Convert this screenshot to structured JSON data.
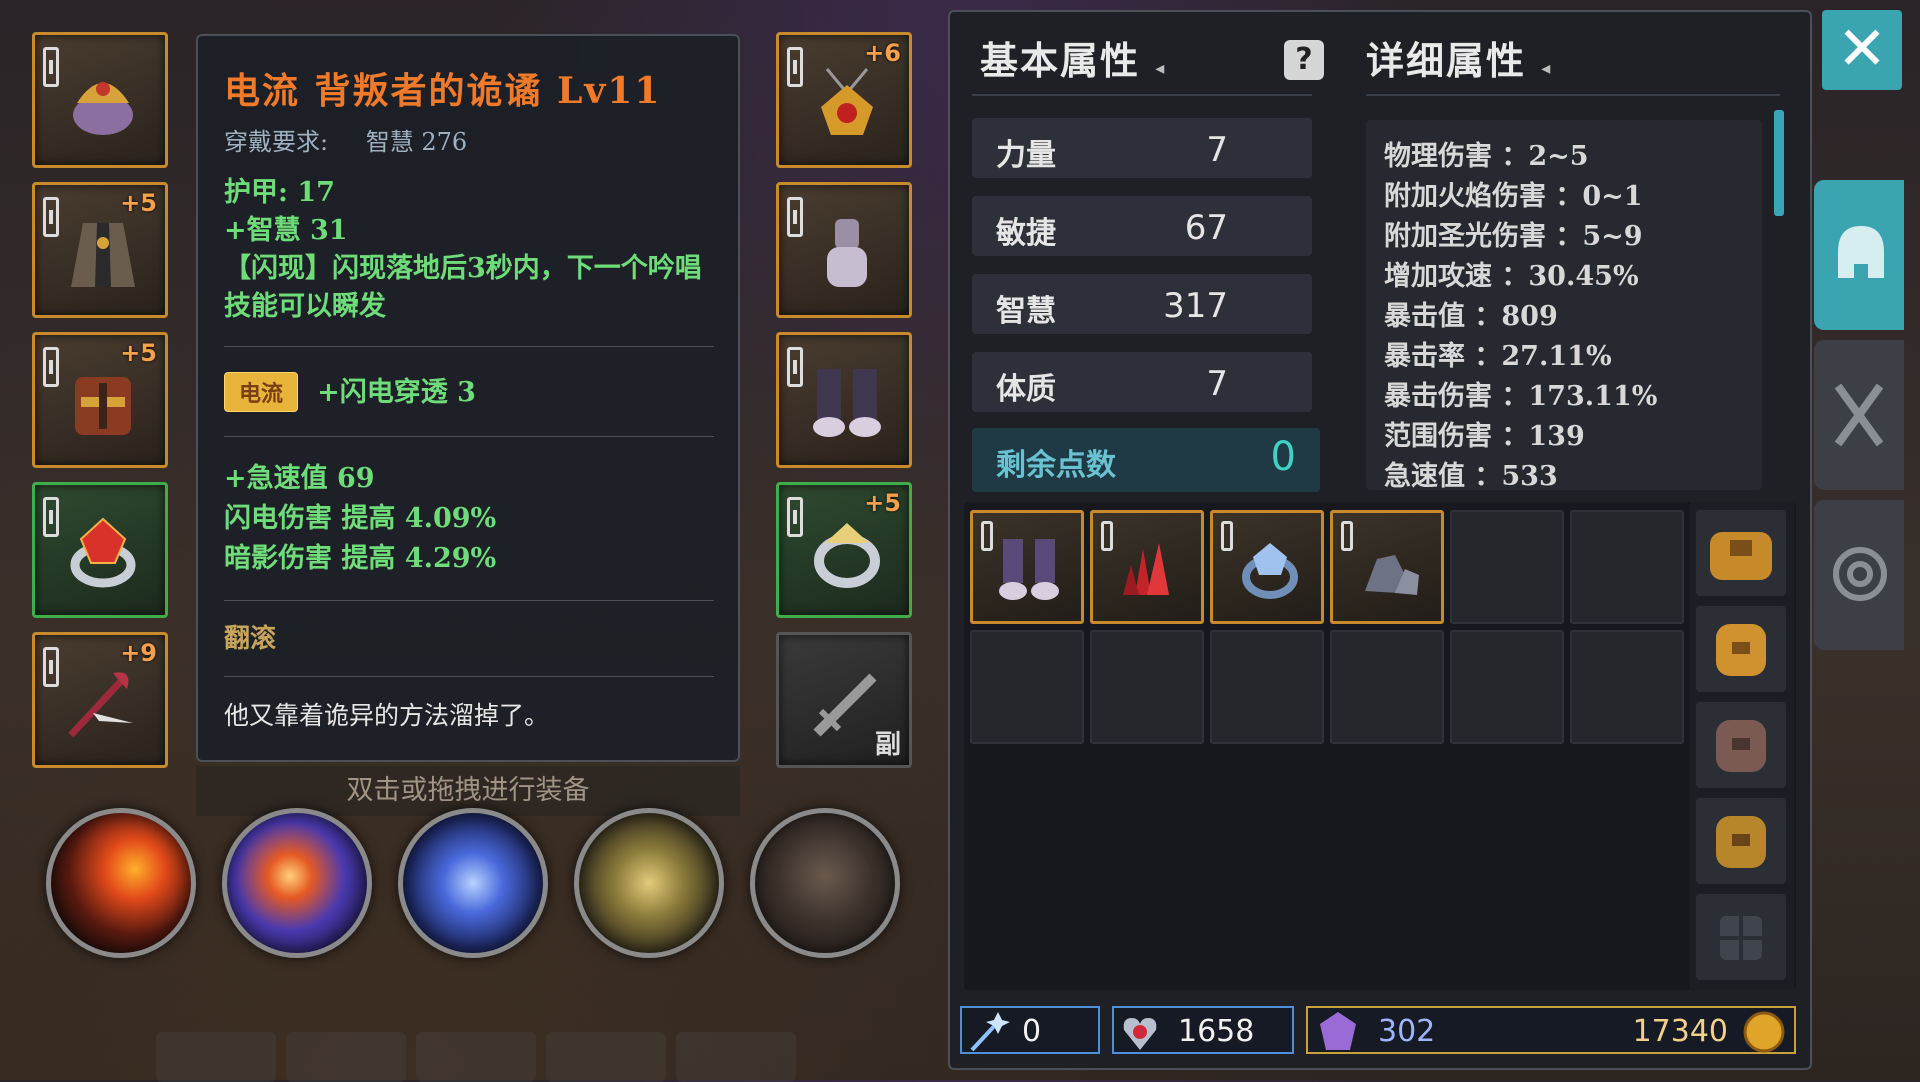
{
  "tooltip": {
    "title": "电流 背叛者的诡谲 Lv11",
    "req_label": "穿戴要求:",
    "req_value": "智慧 276",
    "armor": "护甲:  17",
    "int_bonus": "+智慧 31",
    "effect_line1": "【闪现】闪现落地后3秒内，下一个吟唱",
    "effect_line2": "技能可以瞬发",
    "element_tag": "电流",
    "element_bonus": "+闪电穿透 3",
    "haste": "+急速值 69",
    "lightning": "闪电伤害  提高  4.09%",
    "shadow": "暗影伤害  提高  4.29%",
    "skill_name": "翻滚",
    "flavor": "他又靠着诡异的方法溜掉了。"
  },
  "hint": "双击或拖拽进行装备",
  "equip_left": [
    {
      "name": "helmet-slot",
      "plus": "",
      "icon": "wizard-hat-icon"
    },
    {
      "name": "chest-slot",
      "plus": "+5",
      "icon": "robe-icon"
    },
    {
      "name": "waist-slot",
      "plus": "+5",
      "icon": "belt-armor-icon"
    },
    {
      "name": "ring-slot",
      "plus": "",
      "icon": "ruby-ring-icon"
    },
    {
      "name": "weapon-slot",
      "plus": "+9",
      "icon": "staff-icon"
    }
  ],
  "equip_right": [
    {
      "name": "amulet-slot",
      "plus": "+6",
      "icon": "amulet-icon"
    },
    {
      "name": "gloves-slot",
      "plus": "",
      "icon": "gauntlet-icon"
    },
    {
      "name": "boots-slot",
      "plus": "",
      "icon": "boots-icon"
    },
    {
      "name": "ring2-slot",
      "plus": "+5",
      "icon": "silver-ring-icon"
    },
    {
      "name": "offhand-slot",
      "plus": "",
      "icon": "sword-icon",
      "label": "副"
    }
  ],
  "basic": {
    "header": "基本属性",
    "stats": [
      {
        "label": "力量",
        "value": "7"
      },
      {
        "label": "敏捷",
        "value": "67"
      },
      {
        "label": "智慧",
        "value": "317"
      },
      {
        "label": "体质",
        "value": "7"
      }
    ],
    "remain_label": "剩余点数",
    "remain_value": "0"
  },
  "detail": {
    "header": "详细属性",
    "rows": [
      "物理伤害 ：2~5",
      "附加火焰伤害 ：0~1",
      "附加圣光伤害 ：5~9",
      "增加攻速 ：30.45%",
      "暴击值 ：809",
      "暴击率 ：27.11%",
      "暴击伤害 ：173.11%",
      "范围伤害 ：139",
      "急速值 ：533"
    ]
  },
  "inventory": [
    {
      "icon": "boots-icon",
      "filled": true
    },
    {
      "icon": "red-crystal-icon",
      "filled": true
    },
    {
      "icon": "blue-gem-ring-icon",
      "filled": true
    },
    {
      "icon": "ore-icon",
      "filled": true
    },
    {
      "icon": "",
      "filled": false
    },
    {
      "icon": "",
      "filled": false
    },
    {
      "icon": "",
      "filled": false
    },
    {
      "icon": "",
      "filled": false
    },
    {
      "icon": "",
      "filled": false
    },
    {
      "icon": "",
      "filled": false
    },
    {
      "icon": "",
      "filled": false
    },
    {
      "icon": "",
      "filled": false
    }
  ],
  "currency": {
    "wand": "0",
    "hearts": "1658",
    "gems": "302",
    "gold": "17340"
  },
  "colors": {
    "accent": "#3aa5b0",
    "title_orange": "#f07a2a",
    "stat_green": "#6fdc7a",
    "border_gold": "#c88a2a"
  }
}
